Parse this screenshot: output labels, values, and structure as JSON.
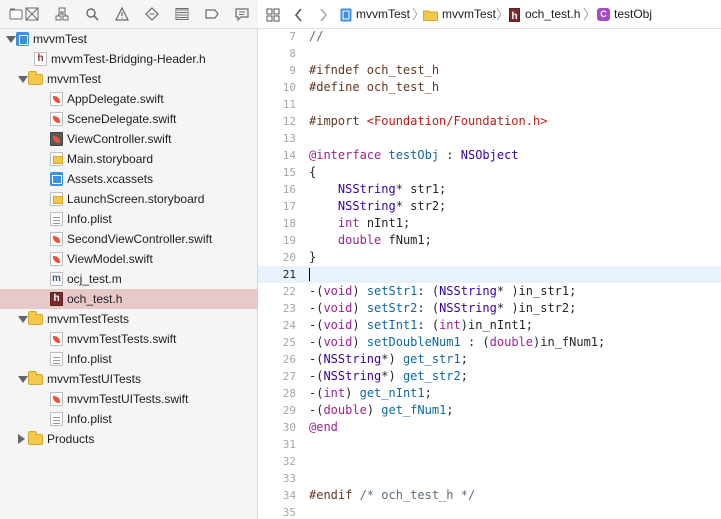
{
  "navigator": {
    "toolbar_icons": [
      "folder-icon",
      "source-control-icon",
      "hierarchy-icon",
      "search-icon",
      "warning-icon",
      "test-icon",
      "debug-icon",
      "breakpoint-icon",
      "report-icon"
    ],
    "items": [
      {
        "label": "mvvmTest",
        "icon": "project-icon",
        "level": 0,
        "disclosure": "open",
        "selected": false
      },
      {
        "label": "mvvmTest-Bridging-Header.h",
        "icon": "header-file-icon",
        "level": 1,
        "disclosure": "none",
        "selected": false
      },
      {
        "label": "mvvmTest",
        "icon": "folder-icon",
        "level": 1,
        "disclosure": "open",
        "selected": false
      },
      {
        "label": "AppDelegate.swift",
        "icon": "swift-file-icon",
        "level": 2,
        "disclosure": "none",
        "selected": false
      },
      {
        "label": "SceneDelegate.swift",
        "icon": "swift-file-icon",
        "level": 2,
        "disclosure": "none",
        "selected": false
      },
      {
        "label": "ViewController.swift",
        "icon": "swift-file-dark-icon",
        "level": 2,
        "disclosure": "none",
        "selected": false
      },
      {
        "label": "Main.storyboard",
        "icon": "storyboard-icon",
        "level": 2,
        "disclosure": "none",
        "selected": false
      },
      {
        "label": "Assets.xcassets",
        "icon": "asset-catalog-icon",
        "level": 2,
        "disclosure": "none",
        "selected": false
      },
      {
        "label": "LaunchScreen.storyboard",
        "icon": "storyboard-icon",
        "level": 2,
        "disclosure": "none",
        "selected": false
      },
      {
        "label": "Info.plist",
        "icon": "plist-file-icon",
        "level": 2,
        "disclosure": "none",
        "selected": false
      },
      {
        "label": "SecondViewController.swift",
        "icon": "swift-file-icon",
        "level": 2,
        "disclosure": "none",
        "selected": false
      },
      {
        "label": "ViewModel.swift",
        "icon": "swift-file-icon",
        "level": 2,
        "disclosure": "none",
        "selected": false
      },
      {
        "label": "ocj_test.m",
        "icon": "objc-implementation-file-icon",
        "level": 2,
        "disclosure": "none",
        "selected": false
      },
      {
        "label": "och_test.h",
        "icon": "header-file-icon",
        "level": 2,
        "disclosure": "none",
        "selected": true
      },
      {
        "label": "mvvmTestTests",
        "icon": "folder-icon",
        "level": 1,
        "disclosure": "open",
        "selected": false
      },
      {
        "label": "mvvmTestTests.swift",
        "icon": "swift-file-icon",
        "level": 2,
        "disclosure": "none",
        "selected": false
      },
      {
        "label": "Info.plist",
        "icon": "plist-file-icon",
        "level": 2,
        "disclosure": "none",
        "selected": false
      },
      {
        "label": "mvvmTestUITests",
        "icon": "folder-icon",
        "level": 1,
        "disclosure": "open",
        "selected": false
      },
      {
        "label": "mvvmTestUITests.swift",
        "icon": "swift-file-icon",
        "level": 2,
        "disclosure": "none",
        "selected": false
      },
      {
        "label": "Info.plist",
        "icon": "plist-file-icon",
        "level": 2,
        "disclosure": "none",
        "selected": false
      },
      {
        "label": "Products",
        "icon": "folder-icon",
        "level": 1,
        "disclosure": "closed",
        "selected": false
      }
    ]
  },
  "jumpbar": {
    "icons": [
      "grid-icon",
      "back-arrow-icon",
      "forward-arrow-icon"
    ],
    "crumbs": [
      {
        "label": "mvvmTest",
        "icon": "project-icon"
      },
      {
        "label": "mvvmTest",
        "icon": "folder-icon"
      },
      {
        "label": "och_test.h",
        "icon": "header-file-icon"
      },
      {
        "label": "testObj",
        "icon": "class-icon"
      }
    ],
    "class_badge": "C"
  },
  "editor": {
    "current_line": "21",
    "lines": [
      {
        "n": "7",
        "tokens": [
          {
            "t": "//",
            "c": "cm"
          }
        ]
      },
      {
        "n": "8",
        "tokens": []
      },
      {
        "n": "9",
        "tokens": [
          {
            "t": "#ifndef och_test_h",
            "c": "pp"
          }
        ]
      },
      {
        "n": "10",
        "tokens": [
          {
            "t": "#define och_test_h",
            "c": "pp"
          }
        ]
      },
      {
        "n": "11",
        "tokens": []
      },
      {
        "n": "12",
        "tokens": [
          {
            "t": "#import ",
            "c": "pp"
          },
          {
            "t": "<Foundation/Foundation.h>",
            "c": "str"
          }
        ]
      },
      {
        "n": "13",
        "tokens": []
      },
      {
        "n": "14",
        "tokens": [
          {
            "t": "@interface",
            "c": "kw"
          },
          {
            "t": " ",
            "c": ""
          },
          {
            "t": "testObj",
            "c": "decl"
          },
          {
            "t": " : ",
            "c": ""
          },
          {
            "t": "NSObject",
            "c": "type"
          }
        ]
      },
      {
        "n": "15",
        "tokens": [
          {
            "t": "{",
            "c": ""
          }
        ]
      },
      {
        "n": "16",
        "tokens": [
          {
            "t": "    ",
            "c": ""
          },
          {
            "t": "NSString",
            "c": "type"
          },
          {
            "t": "* str1;",
            "c": ""
          }
        ]
      },
      {
        "n": "17",
        "tokens": [
          {
            "t": "    ",
            "c": ""
          },
          {
            "t": "NSString",
            "c": "type"
          },
          {
            "t": "* str2;",
            "c": ""
          }
        ]
      },
      {
        "n": "18",
        "tokens": [
          {
            "t": "    ",
            "c": ""
          },
          {
            "t": "int",
            "c": "kw"
          },
          {
            "t": " nInt1;",
            "c": ""
          }
        ]
      },
      {
        "n": "19",
        "tokens": [
          {
            "t": "    ",
            "c": ""
          },
          {
            "t": "double",
            "c": "kw"
          },
          {
            "t": " fNum1;",
            "c": ""
          }
        ]
      },
      {
        "n": "20",
        "tokens": [
          {
            "t": "}",
            "c": ""
          }
        ]
      },
      {
        "n": "21",
        "tokens": []
      },
      {
        "n": "22",
        "tokens": [
          {
            "t": "-(",
            "c": ""
          },
          {
            "t": "void",
            "c": "kw"
          },
          {
            "t": ") ",
            "c": ""
          },
          {
            "t": "setStr1",
            "c": "decl"
          },
          {
            "t": ": (",
            "c": ""
          },
          {
            "t": "NSString",
            "c": "type"
          },
          {
            "t": "* )in_str1;",
            "c": ""
          }
        ]
      },
      {
        "n": "23",
        "tokens": [
          {
            "t": "-(",
            "c": ""
          },
          {
            "t": "void",
            "c": "kw"
          },
          {
            "t": ") ",
            "c": ""
          },
          {
            "t": "setStr2",
            "c": "decl"
          },
          {
            "t": ": (",
            "c": ""
          },
          {
            "t": "NSString",
            "c": "type"
          },
          {
            "t": "* )in_str2;",
            "c": ""
          }
        ]
      },
      {
        "n": "24",
        "tokens": [
          {
            "t": "-(",
            "c": ""
          },
          {
            "t": "void",
            "c": "kw"
          },
          {
            "t": ") ",
            "c": ""
          },
          {
            "t": "setInt1",
            "c": "decl"
          },
          {
            "t": ": (",
            "c": ""
          },
          {
            "t": "int",
            "c": "kw"
          },
          {
            "t": ")in_nInt1;",
            "c": ""
          }
        ]
      },
      {
        "n": "25",
        "tokens": [
          {
            "t": "-(",
            "c": ""
          },
          {
            "t": "void",
            "c": "kw"
          },
          {
            "t": ") ",
            "c": ""
          },
          {
            "t": "setDoubleNum1",
            "c": "decl"
          },
          {
            "t": " : (",
            "c": ""
          },
          {
            "t": "double",
            "c": "kw"
          },
          {
            "t": ")in_fNum1;",
            "c": ""
          }
        ]
      },
      {
        "n": "26",
        "tokens": [
          {
            "t": "-(",
            "c": ""
          },
          {
            "t": "NSString",
            "c": "type"
          },
          {
            "t": "*) ",
            "c": ""
          },
          {
            "t": "get_str1",
            "c": "decl"
          },
          {
            "t": ";",
            "c": ""
          }
        ]
      },
      {
        "n": "27",
        "tokens": [
          {
            "t": "-(",
            "c": ""
          },
          {
            "t": "NSString",
            "c": "type"
          },
          {
            "t": "*) ",
            "c": ""
          },
          {
            "t": "get_str2",
            "c": "decl"
          },
          {
            "t": ";",
            "c": ""
          }
        ]
      },
      {
        "n": "28",
        "tokens": [
          {
            "t": "-(",
            "c": ""
          },
          {
            "t": "int",
            "c": "kw"
          },
          {
            "t": ") ",
            "c": ""
          },
          {
            "t": "get_nInt1",
            "c": "decl"
          },
          {
            "t": ";",
            "c": ""
          }
        ]
      },
      {
        "n": "29",
        "tokens": [
          {
            "t": "-(",
            "c": ""
          },
          {
            "t": "double",
            "c": "kw"
          },
          {
            "t": ") ",
            "c": ""
          },
          {
            "t": "get_fNum1",
            "c": "decl"
          },
          {
            "t": ";",
            "c": ""
          }
        ]
      },
      {
        "n": "30",
        "tokens": [
          {
            "t": "@end",
            "c": "kw"
          }
        ]
      },
      {
        "n": "31",
        "tokens": []
      },
      {
        "n": "32",
        "tokens": []
      },
      {
        "n": "33",
        "tokens": []
      },
      {
        "n": "34",
        "tokens": [
          {
            "t": "#endif ",
            "c": "pp"
          },
          {
            "t": "/* och_test_h */",
            "c": "cm"
          }
        ]
      },
      {
        "n": "35",
        "tokens": []
      }
    ]
  },
  "colors": {
    "keyword": "#9b2393",
    "type": "#3900a0",
    "declaration": "#0f68a0",
    "string": "#c41a16",
    "preprocessor": "#643820",
    "comment": "#5d6c79",
    "selection_row": "#e8c9c9",
    "current_line": "#e8f2fe",
    "folder": "#f2c94c",
    "accent": "#3d8fe5",
    "class_badge": "#a44ac9"
  }
}
